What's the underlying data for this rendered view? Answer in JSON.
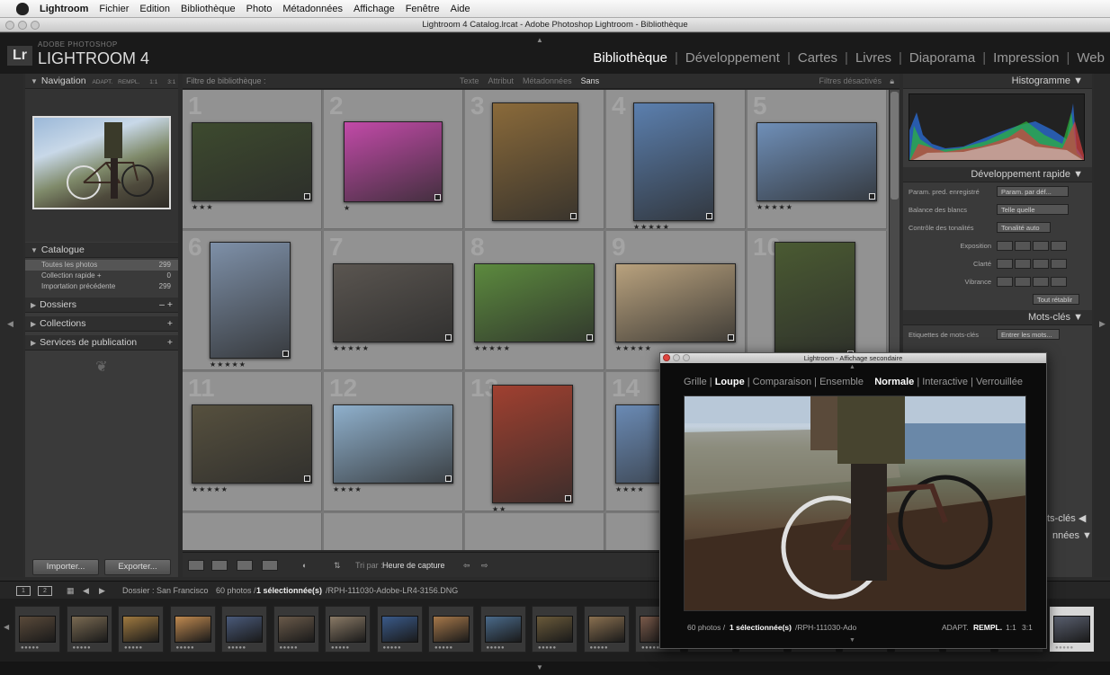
{
  "menubar": {
    "app": "Lightroom",
    "items": [
      "Fichier",
      "Edition",
      "Bibliothèque",
      "Photo",
      "Métadonnées",
      "Affichage",
      "Fenêtre",
      "Aide"
    ]
  },
  "window": {
    "title": "Lightroom 4 Catalog.lrcat - Adobe Photoshop Lightroom - Bibliothèque"
  },
  "identity": {
    "logo": "Lr",
    "sub": "ADOBE PHOTOSHOP",
    "name": "LIGHTROOM 4"
  },
  "modules": [
    "Bibliothèque",
    "Développement",
    "Cartes",
    "Livres",
    "Diaporama",
    "Impression",
    "Web"
  ],
  "left": {
    "navigation": {
      "title": "Navigation",
      "options": [
        "ADAPT.",
        "REMPL.",
        "1:1",
        "3:1"
      ]
    },
    "catalogue": {
      "title": "Catalogue",
      "items": [
        {
          "label": "Toutes les photos",
          "count": "299"
        },
        {
          "label": "Collection rapide +",
          "count": "0"
        },
        {
          "label": "Importation précédente",
          "count": "299"
        }
      ]
    },
    "dossiers": "Dossiers",
    "collections": "Collections",
    "services": "Services de publication",
    "import_btn": "Importer...",
    "export_btn": "Exporter..."
  },
  "filterbar": {
    "title": "Filtre de bibliothèque :",
    "options": [
      "Texte",
      "Attribut",
      "Métadonnées",
      "Sans"
    ],
    "right": "Filtres désactivés"
  },
  "grid": {
    "cells": [
      {
        "num": "1",
        "stars": "★★★",
        "c": "#3d4a2e"
      },
      {
        "num": "2",
        "stars": "★",
        "c": "#c24aa8"
      },
      {
        "num": "3",
        "stars": "",
        "c": "#8a6a3a"
      },
      {
        "num": "4",
        "stars": "★★★★★",
        "c": "#5b7fae"
      },
      {
        "num": "5",
        "stars": "★★★★★",
        "c": "#6f8fb8"
      },
      {
        "num": "6",
        "stars": "★★★★★",
        "c": "#7e90a8"
      },
      {
        "num": "7",
        "stars": "★★★★★",
        "c": "#5a5550"
      },
      {
        "num": "8",
        "stars": "★★★★★",
        "c": "#5c8a3e"
      },
      {
        "num": "9",
        "stars": "★★★★★",
        "c": "#b9a27e"
      },
      {
        "num": "10",
        "stars": "",
        "c": "#4a5a32"
      },
      {
        "num": "11",
        "stars": "★★★★★",
        "c": "#56503e"
      },
      {
        "num": "12",
        "stars": "★★★★",
        "c": "#8fb0cc"
      },
      {
        "num": "13",
        "stars": "★★",
        "c": "#a04030"
      },
      {
        "num": "14",
        "stars": "★★★★",
        "c": "#6a8ab4"
      }
    ]
  },
  "toolbar": {
    "sort_label": "Tri par :",
    "sort_value": "Heure de capture"
  },
  "right": {
    "histogram": "Histogramme",
    "quickdev": "Développement rapide",
    "param_label": "Param. pred. enregistré",
    "param_value": "Param. par déf...",
    "wb_label": "Balance des blancs",
    "wb_value": "Telle quelle",
    "tone_label": "Contrôle des tonalités",
    "tone_btn": "Tonalité auto",
    "exposure": "Exposition",
    "clarity": "Clarté",
    "vibrance": "Vibrance",
    "reset_btn": "Tout rétablir",
    "keywords": "Mots-clés",
    "kw_label": "Etiquettes de mots-clés",
    "kw_value": "Entrer les mots...",
    "keylist_partial": "ts-clés",
    "metadata_partial": "nnées"
  },
  "filmhead": {
    "folder": "Dossier : San Francisco",
    "count": "60 photos /",
    "selected": "1 sélectionnée(s)",
    "file": "/RPH-111030-Adobe-LR4-3156.DNG"
  },
  "secondary": {
    "title": "Lightroom - Affichage secondaire",
    "nav": [
      "Grille",
      "Loupe",
      "Comparaison",
      "Ensemble",
      "Normale",
      "Interactive",
      "Verrouillée"
    ],
    "footer_count": "60 photos /",
    "footer_sel": "1 sélectionnée(s)",
    "footer_file": "/RPH-111030-Ado",
    "zoom": [
      "ADAPT.",
      "REMPL.",
      "1:1",
      "3:1"
    ]
  },
  "filmstrip": {
    "colors": [
      "#5a4a3a",
      "#7a6a52",
      "#a07a40",
      "#c08a50",
      "#4a5a7a",
      "#6a5a4a",
      "#8a7a66",
      "#3a5a8a",
      "#a6784a",
      "#4a6a8a",
      "#6a5a3a",
      "#8a7050",
      "#7a5a4a",
      "#5a6a7a",
      "#6a6a5a",
      "#7a8aa0",
      "#4a4a3a",
      "#8a9ab0",
      "#5a5a4a",
      "#9aaac0",
      "#5a6070"
    ]
  },
  "colors": {
    "active_module": "#ffffff",
    "panel": "#3a3a3a",
    "grid_bg": "#787878"
  }
}
